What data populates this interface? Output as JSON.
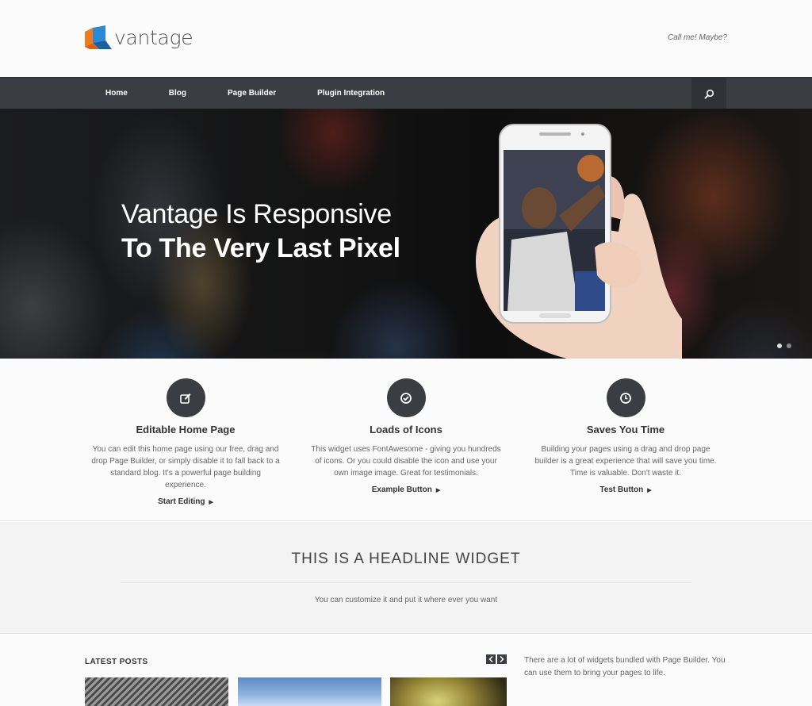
{
  "header": {
    "logo_text": "vantage",
    "tagline": "Call me! Maybe?"
  },
  "nav": {
    "items": [
      "Home",
      "Blog",
      "Page Builder",
      "Plugin Integration"
    ],
    "search_icon": "search-icon"
  },
  "hero": {
    "title_line1": "Vantage Is Responsive",
    "title_line2": "To The Very Last Pixel",
    "slides": 2,
    "active_slide": 1
  },
  "features": [
    {
      "icon": "edit-icon",
      "title": "Editable Home Page",
      "text": "You can edit this home page using our free, drag and drop Page Builder, or simply disable it to fall back to a standard blog. It's a powerful page building experience.",
      "link": "Start Editing"
    },
    {
      "icon": "check-circle-icon",
      "title": "Loads of Icons",
      "text": "This widget uses FontAwesome - giving you hundreds of icons. Or you could disable the icon and use your own image image. Great for testimonials.",
      "link": "Example Button"
    },
    {
      "icon": "clock-icon",
      "title": "Saves You Time",
      "text": "Building your pages using a drag and drop page builder is a great experience that will save you time. Time is valuable. Don't waste it.",
      "link": "Test Button"
    }
  ],
  "headline": {
    "title": "THIS IS A HEADLINE WIDGET",
    "subtitle": "You can customize it and put it where ever you want"
  },
  "posts": {
    "title": "LATEST POSTS",
    "side_text": "There are a lot of widgets bundled with Page Builder. You can use them to bring your pages to life."
  },
  "colors": {
    "nav_bg": "#3a3d41",
    "accent_blue": "#1e73be",
    "accent_orange": "#f07b1f"
  }
}
